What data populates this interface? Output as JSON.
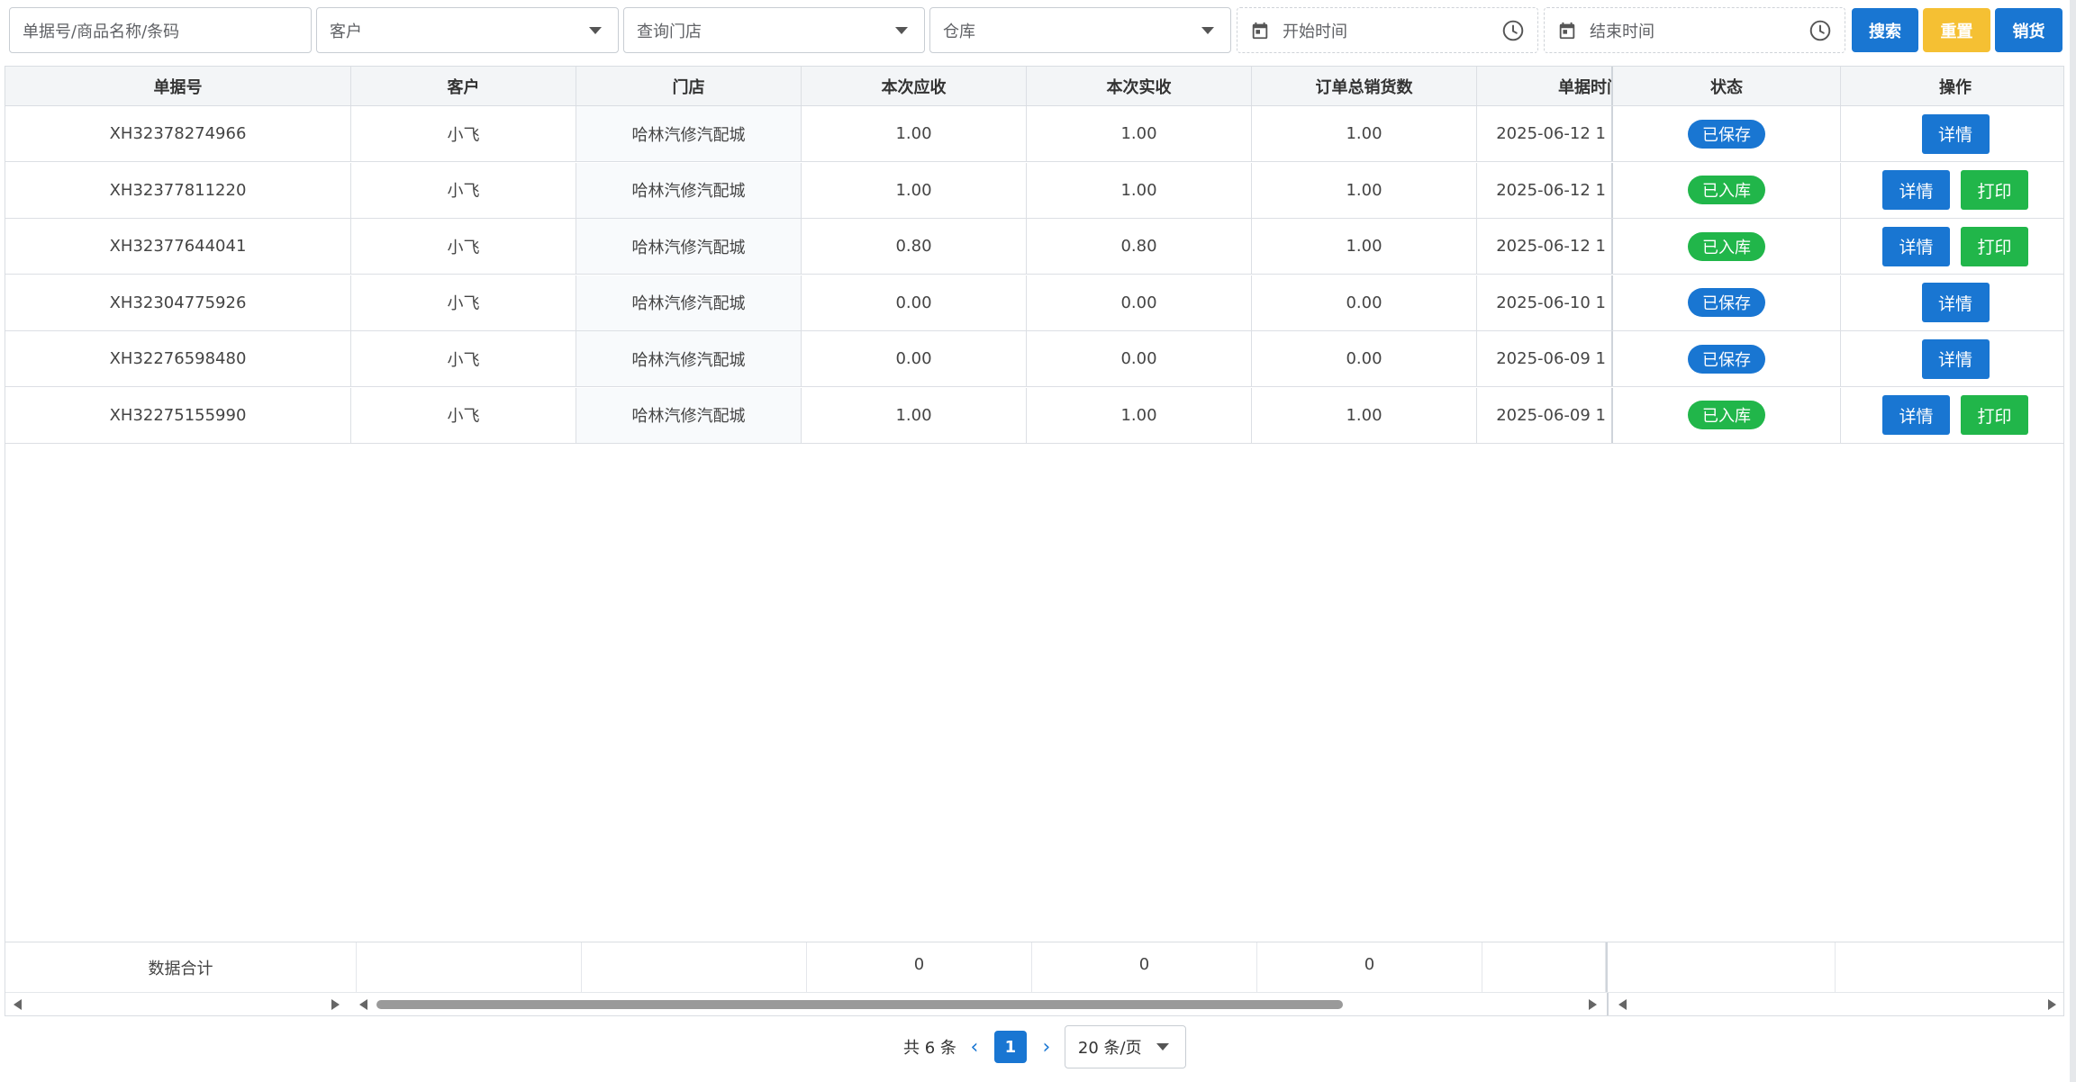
{
  "filters": {
    "search_placeholder": "单据号/商品名称/条码",
    "customer_placeholder": "客户",
    "store_placeholder": "查询门店",
    "warehouse_placeholder": "仓库",
    "start_time_placeholder": "开始时间",
    "end_time_placeholder": "结束时间"
  },
  "toolbar": {
    "search_label": "搜索",
    "reset_label": "重置",
    "sale_label": "销货",
    "colors": {
      "primary": "#1976d2",
      "warning": "#f5c033",
      "success": "#21b64a"
    }
  },
  "table": {
    "headers": {
      "order_no": "单据号",
      "customer": "客户",
      "store": "门店",
      "receivable": "本次应收",
      "received": "本次实收",
      "total_qty": "订单总销货数",
      "order_time": "单据时间",
      "status": "状态",
      "actions": "操作"
    },
    "rows": [
      {
        "order_no": "XH32378274966",
        "customer": "小飞",
        "store": "哈林汽修汽配城",
        "receivable": "1.00",
        "received": "1.00",
        "total_qty": "1.00",
        "order_time": "2025-06-12 1",
        "status": "已保存",
        "status_type": "saved",
        "detail_label": "详情"
      },
      {
        "order_no": "XH32377811220",
        "customer": "小飞",
        "store": "哈林汽修汽配城",
        "receivable": "1.00",
        "received": "1.00",
        "total_qty": "1.00",
        "order_time": "2025-06-12 1",
        "status": "已入库",
        "status_type": "stocked",
        "detail_label": "详情",
        "print_label": "打印"
      },
      {
        "order_no": "XH32377644041",
        "customer": "小飞",
        "store": "哈林汽修汽配城",
        "receivable": "0.80",
        "received": "0.80",
        "total_qty": "1.00",
        "order_time": "2025-06-12 1",
        "status": "已入库",
        "status_type": "stocked",
        "detail_label": "详情",
        "print_label": "打印"
      },
      {
        "order_no": "XH32304775926",
        "customer": "小飞",
        "store": "哈林汽修汽配城",
        "receivable": "0.00",
        "received": "0.00",
        "total_qty": "0.00",
        "order_time": "2025-06-10 1",
        "status": "已保存",
        "status_type": "saved",
        "detail_label": "详情"
      },
      {
        "order_no": "XH32276598480",
        "customer": "小飞",
        "store": "哈林汽修汽配城",
        "receivable": "0.00",
        "received": "0.00",
        "total_qty": "0.00",
        "order_time": "2025-06-09 1",
        "status": "已保存",
        "status_type": "saved",
        "detail_label": "详情"
      },
      {
        "order_no": "XH32275155990",
        "customer": "小飞",
        "store": "哈林汽修汽配城",
        "receivable": "1.00",
        "received": "1.00",
        "total_qty": "1.00",
        "order_time": "2025-06-09 1",
        "status": "已入库",
        "status_type": "stocked",
        "detail_label": "详情",
        "print_label": "打印"
      }
    ],
    "summary": {
      "label": "数据合计",
      "receivable": "0",
      "received": "0",
      "total_qty": "0"
    }
  },
  "pagination": {
    "total_text": "共 6 条",
    "current_page": "1",
    "page_size": "20 条/页"
  }
}
